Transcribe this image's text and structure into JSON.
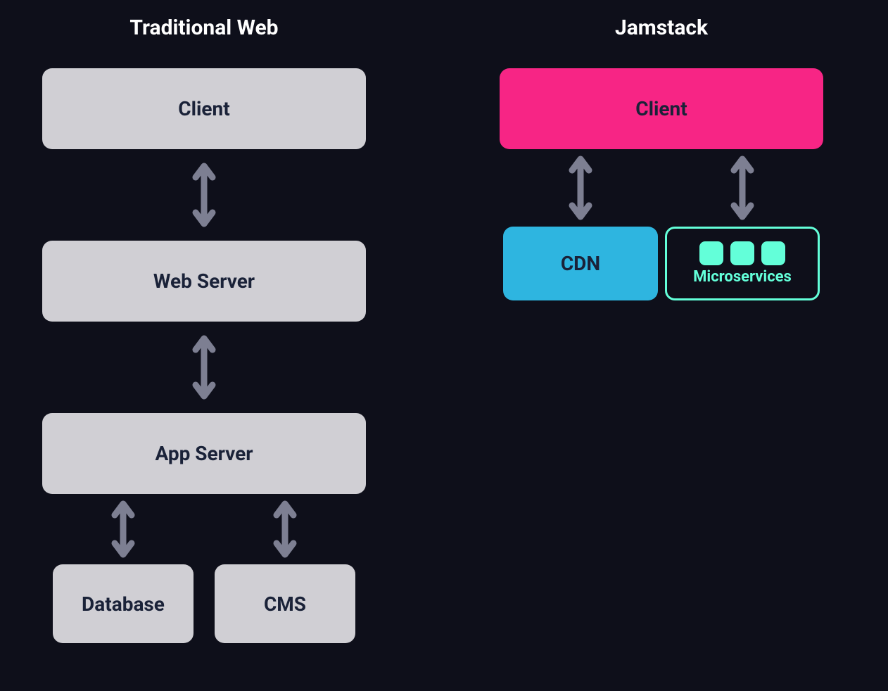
{
  "left": {
    "title": "Traditional Web",
    "boxes": {
      "client": "Client",
      "webserver": "Web Server",
      "appserver": "App Server",
      "database": "Database",
      "cms": "CMS"
    }
  },
  "right": {
    "title": "Jamstack",
    "boxes": {
      "client": "Client",
      "cdn": "CDN",
      "microservices": "Microservices"
    }
  },
  "colors": {
    "background": "#0e0f1a",
    "gray": "#d0cfd4",
    "pink": "#f72585",
    "blue": "#2eb5e0",
    "teal": "#63ffd9",
    "arrow": "#7d7f92",
    "boxText": "#1a2238"
  }
}
